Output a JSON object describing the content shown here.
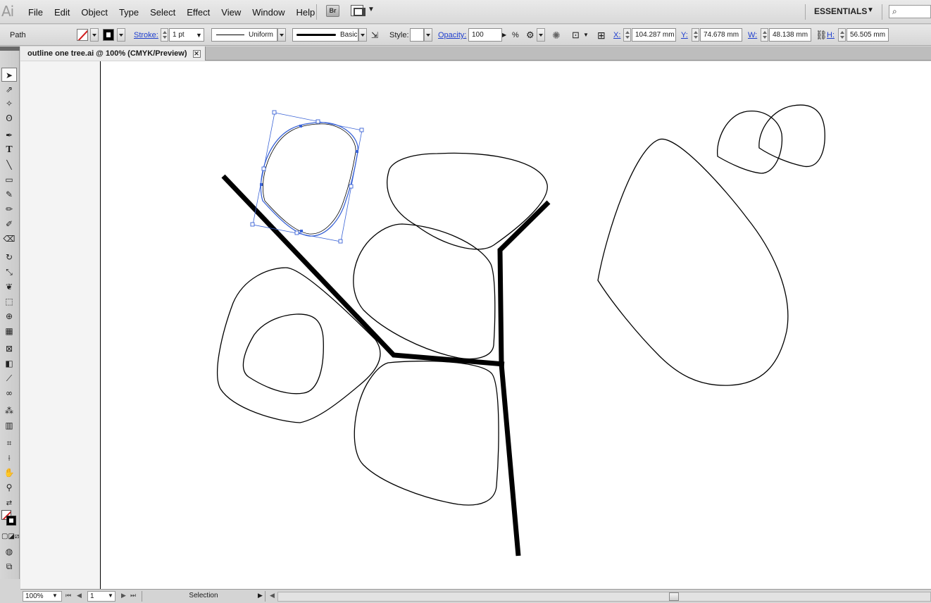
{
  "app": {
    "logo": "Ai",
    "menus": [
      "File",
      "Edit",
      "Object",
      "Type",
      "Select",
      "Effect",
      "View",
      "Window",
      "Help"
    ],
    "bridge_label": "Br",
    "workspace": "ESSENTIALS"
  },
  "control": {
    "object_type": "Path",
    "stroke_label": "Stroke:",
    "stroke_weight": "1 pt",
    "profile": "Uniform",
    "brush": "Basic",
    "style_label": "Style:",
    "opacity_label": "Opacity:",
    "opacity_value": "100",
    "percent": "%",
    "x_label": "X:",
    "x_value": "104.287 mm",
    "y_label": "Y:",
    "y_value": "74.678 mm",
    "w_label": "W:",
    "w_value": "48.138 mm",
    "h_label": "H:",
    "h_value": "56.505 mm"
  },
  "document": {
    "tab_title": "outline one tree.ai @ 100% (CMYK/Preview)",
    "close_glyph": "✕"
  },
  "status": {
    "zoom": "100%",
    "artboard_number": "1",
    "mode": "Selection"
  },
  "colors": {
    "selection": "#3a63d6",
    "artboard": "#ffffff",
    "pasteboard": "#f4f4f4",
    "link": "#1f3fcf"
  }
}
